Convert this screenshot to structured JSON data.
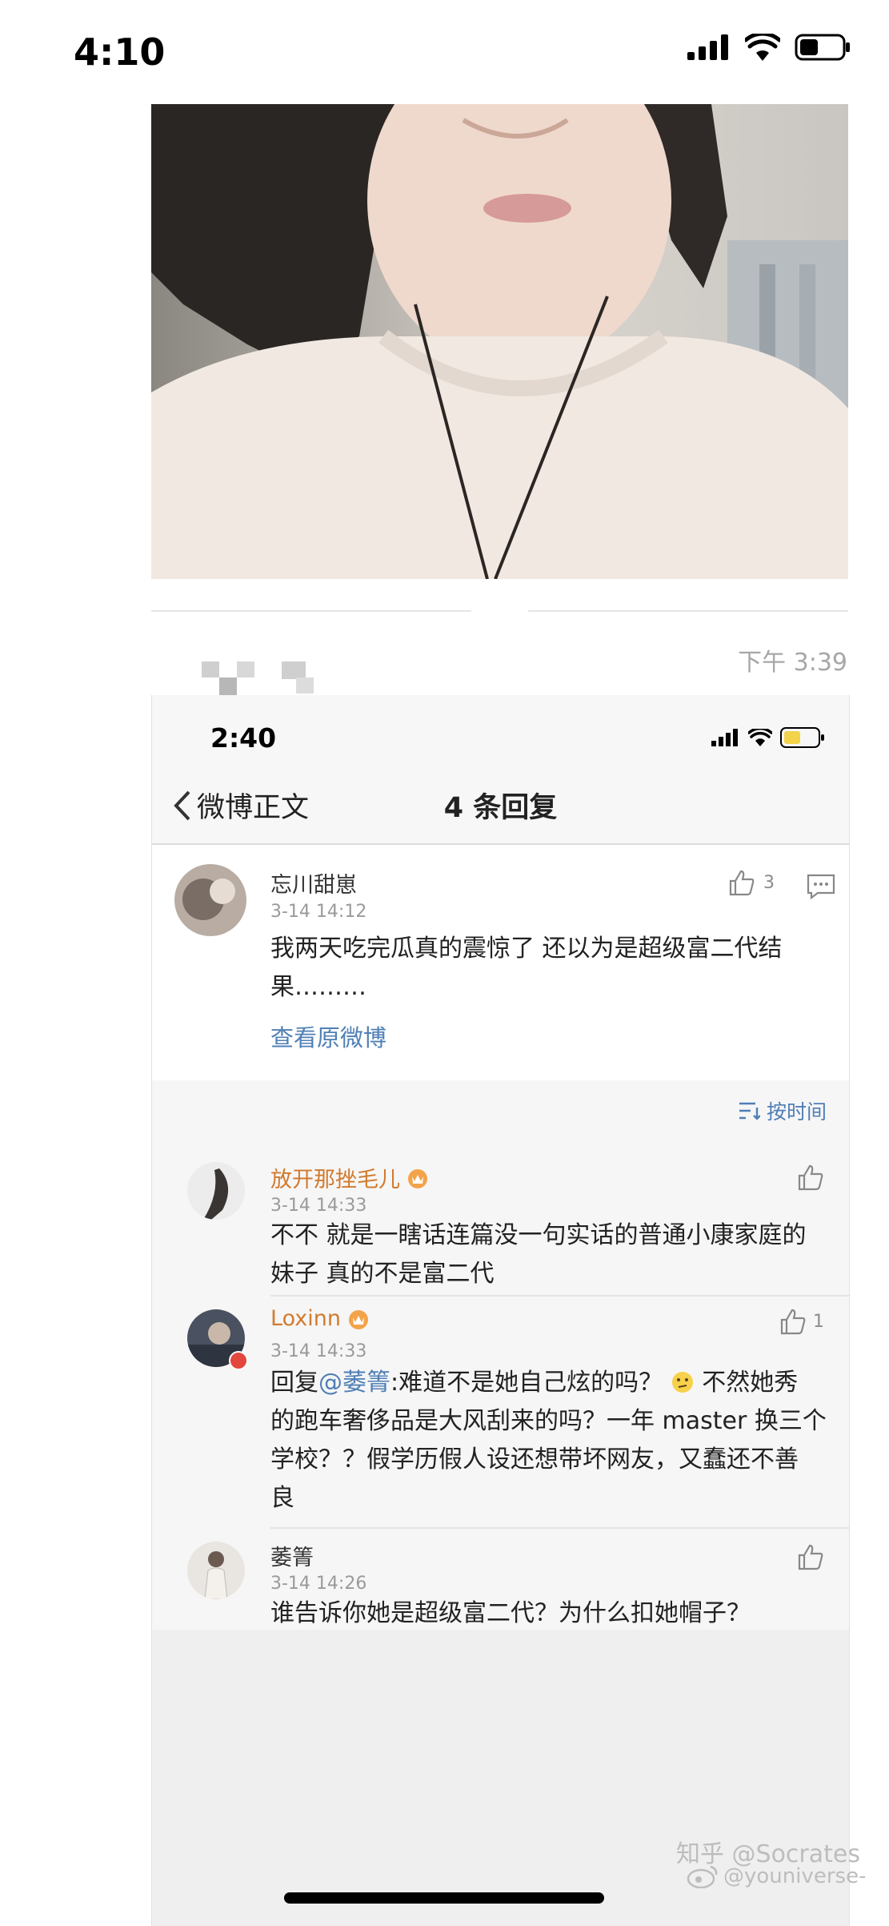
{
  "outer": {
    "status_time": "4:10",
    "message_time": "下午 3:39"
  },
  "screenshot": {
    "status_time": "2:40",
    "nav": {
      "back_label": "微博正文",
      "title": "4 条回复"
    },
    "main_comment": {
      "user": "忘川甜崽",
      "time": "3-14 14:12",
      "likes": "3",
      "text_line1": "我两天吃完瓜真的震惊了 还以为是超级富二代结",
      "text_line2": "果………",
      "view_original": "查看原微博"
    },
    "sort_label": "按时间",
    "replies": [
      {
        "user": "放开那挫毛儿",
        "time": "3-14 14:33",
        "likes": "",
        "lines": [
          "不不 就是一瞎话连篇没一句实话的普通小康家庭的",
          "妹子 真的不是富二代"
        ]
      },
      {
        "user": "Loxinn",
        "time": "3-14 14:33",
        "likes": "1",
        "reply_prefix": "回复",
        "mention": "@萎箐",
        "line1_rest": ":难道不是她自己炫的吗？",
        "line1_tail": "不然她秀",
        "lines": [
          "的跑车奢侈品是大风刮来的吗？一年 master 换三个",
          "学校？？假学历假人设还想带坏网友，又蠢还不善",
          "良"
        ]
      },
      {
        "user": "萎箐",
        "time": "3-14 14:26",
        "likes": "",
        "lines": [
          "谁告诉你她是超级富二代？为什么扣她帽子？"
        ]
      }
    ]
  },
  "watermark": {
    "line1": "知乎 @Socrates",
    "line2": "@youniverse-"
  },
  "colors": {
    "link": "#4f7fb5",
    "vip_name": "#d27a2e",
    "battery": "#f2d34a"
  }
}
